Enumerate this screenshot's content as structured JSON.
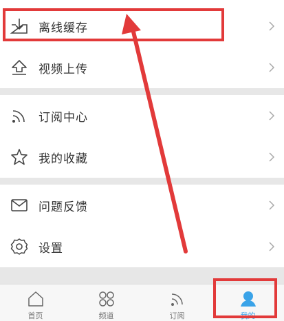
{
  "menu": {
    "items": [
      {
        "label": "离线缓存",
        "icon": "download-icon"
      },
      {
        "label": "视频上传",
        "icon": "upload-icon"
      },
      {
        "label": "订阅中心",
        "icon": "rss-icon"
      },
      {
        "label": "我的收藏",
        "icon": "star-icon"
      },
      {
        "label": "问题反馈",
        "icon": "mail-icon"
      },
      {
        "label": "设置",
        "icon": "gear-icon"
      }
    ]
  },
  "tabbar": {
    "tabs": [
      {
        "label": "首页",
        "icon": "home-icon"
      },
      {
        "label": "频道",
        "icon": "grid-icon"
      },
      {
        "label": "订阅",
        "icon": "rss-icon"
      },
      {
        "label": "我的",
        "icon": "user-icon"
      }
    ],
    "active_index": 3,
    "active_color": "#3aa3e8"
  },
  "annotations": {
    "color": "#e23a3a"
  }
}
